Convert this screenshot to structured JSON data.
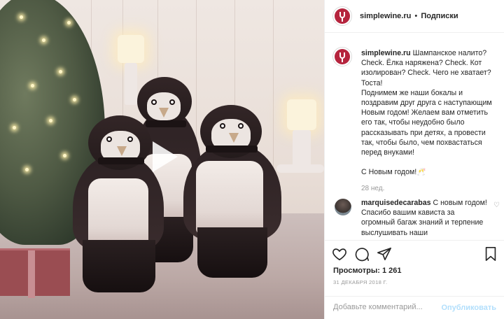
{
  "media": {
    "play_icon": "play-icon"
  },
  "header": {
    "username": "simplewine.ru",
    "separator": "•",
    "follow_label": "Подписки"
  },
  "caption": {
    "username": "simplewine.ru",
    "lines": [
      "Шампанское налито? Check. Ёлка наряжена? Check. Кот изолирован? Check. Чего не хватает? Тоста!",
      "Поднимем же наши бокалы и поздравим друг друга с наступающим Новым годом! Желаем вам отметить его так, чтобы неудобно было рассказывать при детях, а провести так, чтобы было, чем похвастаться перед внуками!",
      "С Новым годом!🥂"
    ],
    "age": "28 нед."
  },
  "reply": {
    "username": "marquisedecarabas",
    "text": "С новым годом! Спасибо вашим кависта за огромный багаж знаний и терпение выслушивать наши"
  },
  "actions": {
    "like_icon": "heart-icon",
    "comment_icon": "comment-icon",
    "share_icon": "share-icon",
    "save_icon": "bookmark-icon"
  },
  "stats": {
    "views": "Просмотры: 1 261",
    "date": "31 ДЕКАБРЯ 2018 Г."
  },
  "comment_box": {
    "placeholder": "Добавьте комментарий...",
    "publish_label": "Опубликовать"
  },
  "colors": {
    "brand": "#b5243d",
    "publish_disabled": "#b2dffc"
  }
}
